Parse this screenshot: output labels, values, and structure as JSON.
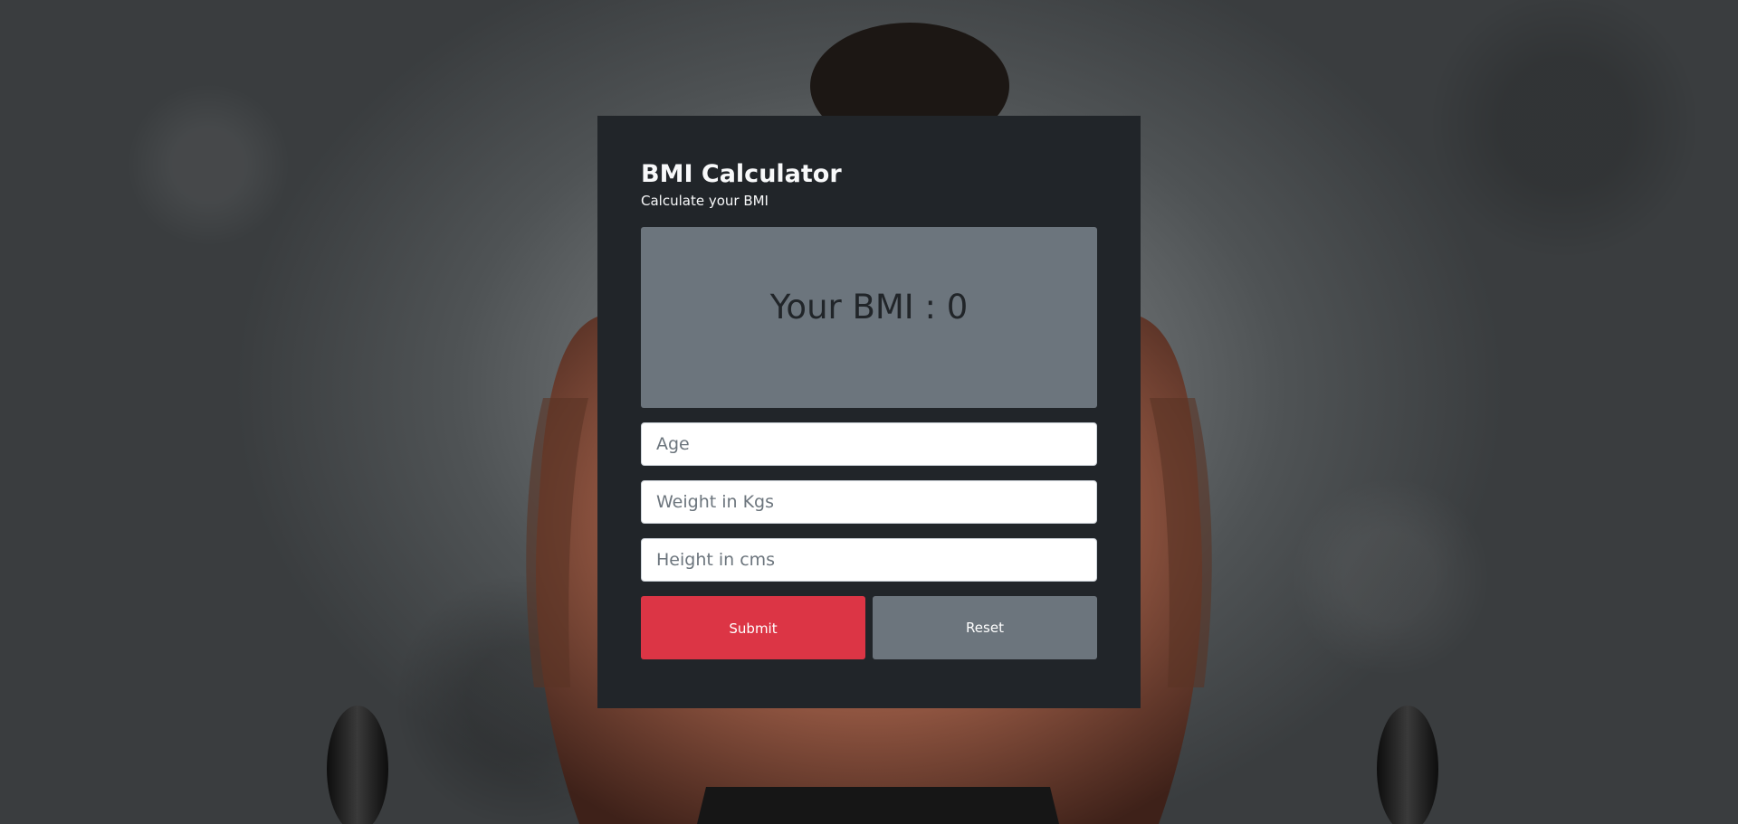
{
  "calculator": {
    "title": "BMI Calculator",
    "subtitle": "Calculate your BMI",
    "result_text": "Your BMI : 0",
    "fields": {
      "age_placeholder": "Age",
      "weight_placeholder": "Weight in Kgs",
      "height_placeholder": "Height in cms"
    },
    "buttons": {
      "submit_label": "Submit",
      "reset_label": "Reset"
    }
  },
  "colors": {
    "card_background": "#212529",
    "result_background": "#6c757d",
    "submit_button": "#dc3545",
    "reset_button": "#6c757d",
    "title_text": "#f8f9fa"
  }
}
